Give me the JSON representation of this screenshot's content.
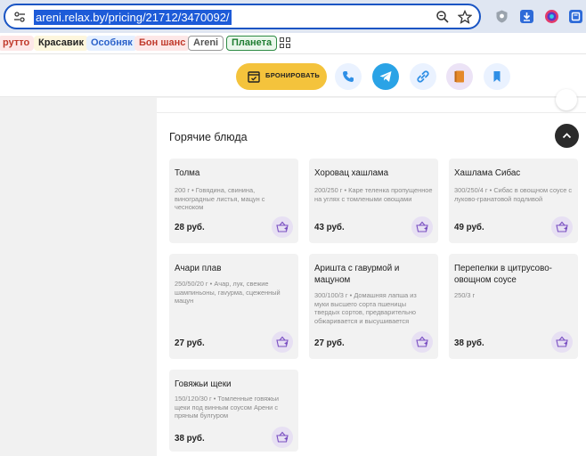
{
  "browser": {
    "url": "areni.relax.by/pricing/21712/3470092/",
    "colors": {
      "selection": "#1d5bd8",
      "focus_ring": "#1a55c4"
    }
  },
  "bookmarks": [
    {
      "label": "рутто",
      "color": "#c0392b",
      "bg": "#fde7e7"
    },
    {
      "label": "Красавик",
      "color": "#222",
      "bg": "#fdf6dd"
    },
    {
      "label": "Особняк",
      "color": "#2a61c9",
      "bg": "#e6f0ff"
    },
    {
      "label": "Бон шанс",
      "color": "#c0392b",
      "bg": "#fde7e7"
    },
    {
      "label": "Areni",
      "color": "#555",
      "bg": "#fff"
    },
    {
      "label": "Планета",
      "color": "#1e7d31",
      "bg": "#eaf7ec"
    }
  ],
  "header": {
    "book_label": "БРОНИРОВАТЬ",
    "actions": [
      "phone-icon",
      "telegram-icon",
      "link-icon",
      "menu-book-icon",
      "bookmark-icon"
    ]
  },
  "section": {
    "title": "Горячие блюда"
  },
  "dishes": [
    {
      "name": "Толма",
      "desc": "200 г • Говядина, свинина, виноградные листья, мацун с чесноком",
      "price": "28 руб."
    },
    {
      "name": "Хоровац хашлама",
      "desc": "200/250 г • Каре теленка пропущенное на углях с томлеными овощами",
      "price": "43 руб."
    },
    {
      "name": "Хашлама Сибас",
      "desc": "300/250/4 г • Сибас в овощном соусе с луково-гранатовой подливой",
      "price": "49 руб."
    },
    {
      "name": "Ачари плав",
      "desc": "250/50/20 г • Ачар, лук, свежие шампиньоны, гаvурма, сцеженный мацун",
      "price": "27 руб."
    },
    {
      "name": "Аришта с гавурмой и мацуном",
      "desc": "300/100/3 г • Домашняя лапша из муки высшего сорта пшеницы твердых сортов, предварительно обжаривается и высушивается",
      "price": "27 руб."
    },
    {
      "name": "Перепелки в цитрусово-овощном соусе",
      "desc": "250/3 г",
      "price": "38 руб."
    },
    {
      "name": "Говяжьи щеки",
      "desc": "150/120/30 г • Томленные говяжьи щеки под винным соусом Арени с пряным булгуром",
      "price": "38 руб."
    }
  ]
}
